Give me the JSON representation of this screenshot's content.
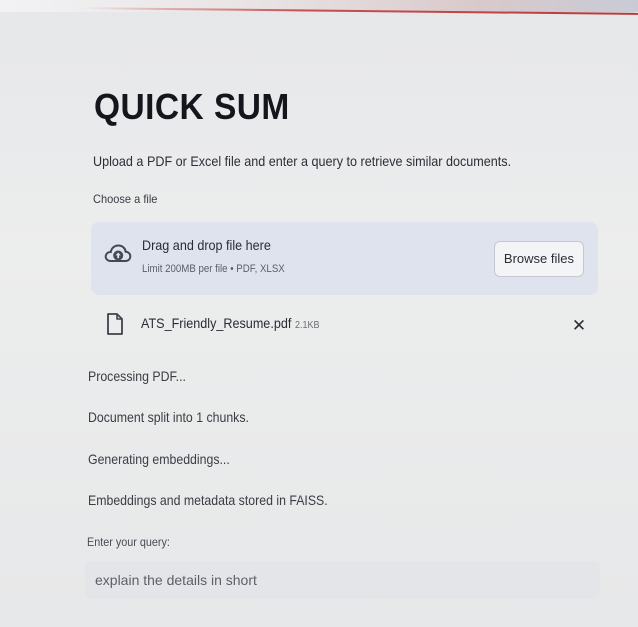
{
  "app": {
    "title": "QUICK SUM",
    "subtitle": "Upload a PDF or Excel file and enter a query to retrieve similar documents."
  },
  "uploader": {
    "label": "Choose a file",
    "drop_title": "Drag and drop file here",
    "limit_text": "Limit 200MB per file • PDF, XLSX",
    "browse_label": "Browse files",
    "icon": "cloud-upload-icon"
  },
  "uploaded_file": {
    "name": "ATS_Friendly_Resume.pdf",
    "size": "2.1KB",
    "icon": "file-icon",
    "remove_label": "✕"
  },
  "status_messages": [
    "Processing PDF...",
    "Document split into 1 chunks.",
    "Generating embeddings...",
    "Embeddings and metadata stored in FAISS."
  ],
  "query": {
    "label": "Enter your query:",
    "value": "explain the details in short"
  },
  "colors": {
    "dropzone_bg": "#dfe3ee",
    "accent_red": "#c85050"
  }
}
